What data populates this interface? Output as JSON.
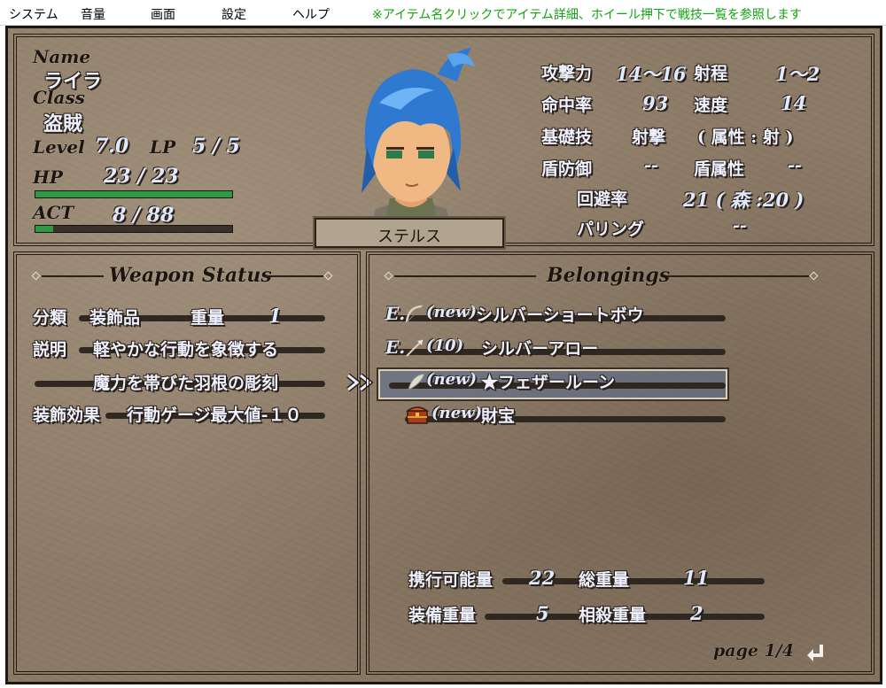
{
  "menu": {
    "items": [
      "システム",
      "音量",
      "画面",
      "設定",
      "ヘルプ"
    ],
    "hint": "※アイテム名クリックでアイテム詳細、ホイール押下で戦技一覧を参照します"
  },
  "character": {
    "name_label": "Name",
    "name": "ライラ",
    "class_label": "Class",
    "class": "盗賊",
    "level_label": "Level",
    "level": "7.0",
    "lp_label": "LP",
    "lp": "5 / 5",
    "hp_label": "HP",
    "hp_text": "23 /  23",
    "hp_fraction": 1.0,
    "act_label": "ACT",
    "act_text": "8 /  88",
    "act_fraction": 0.09,
    "skill": "ステルス"
  },
  "stats": {
    "atk_label": "攻撃力",
    "atk": "14〜16",
    "range_label": "射程",
    "range": "1〜2",
    "hit_label": "命中率",
    "hit": "93",
    "speed_label": "速度",
    "speed": "14",
    "base_label": "基礎技",
    "base": "射撃",
    "attr": "( 属性 : 射 )",
    "shield_label": "盾防御",
    "shield": "--",
    "shield_attr_label": "盾属性",
    "shield_attr": "--",
    "evade_label": "回避率",
    "evade": "21 ( 森 :20 )",
    "parry_label": "パリング",
    "parry": "--"
  },
  "weapon": {
    "title": "Weapon Status",
    "cat_label": "分類",
    "cat": "装飾品",
    "weight_label": "重量",
    "weight": "1",
    "desc_label": "説明",
    "desc1": "軽やかな行動を象徴する",
    "desc2": "魔力を帯びた羽根の彫刻",
    "effect_label": "装飾効果",
    "effect": "行動ゲージ最大値-１０"
  },
  "belongings": {
    "title": "Belongings",
    "items": [
      {
        "equip": "E.",
        "count": "(new)",
        "name": "シルバーショートボウ",
        "icon": "bow-icon"
      },
      {
        "equip": "E.",
        "count": "(10)",
        "name": "シルバーアロー",
        "icon": "arrow-icon"
      },
      {
        "equip": "",
        "count": "(new)",
        "name": "★フェザールーン",
        "icon": "feather-icon"
      },
      {
        "equip": "",
        "count": "(new)",
        "name": "財宝",
        "icon": "treasure-chest-icon"
      }
    ],
    "cap_label": "携行可能量",
    "cap": "22",
    "total_label": "総重量",
    "total": "11",
    "equip_w_label": "装備重量",
    "equip_w": "5",
    "offset_label": "相殺重量",
    "offset": "2",
    "page": "page 1/4"
  },
  "colors": {
    "hp_bar": "#2e9a44",
    "act_bar": "#2e9a44",
    "hint": "#12a412"
  }
}
